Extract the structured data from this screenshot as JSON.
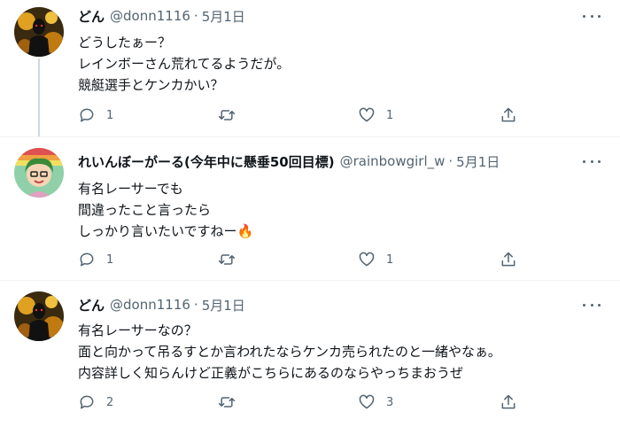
{
  "tweets": [
    {
      "name": "どん",
      "handle": "@donn1116",
      "separator": "·",
      "date": "5月1日",
      "lines": [
        "どうしたぁー？",
        "レインボーさん荒れてるようだが。",
        "競艇選手とケンカかい？"
      ],
      "reply_count": "1",
      "retweet_count": "",
      "like_count": "1",
      "avatar_icon": "dark-figure-avatar"
    },
    {
      "name": "れいんぼーがーる(今年中に懸垂50回目標)",
      "handle": "@rainbowgirl_w",
      "separator": "·",
      "date": "5月1日",
      "lines": [
        "有名レーサーでも",
        "間違ったこと言ったら",
        "しっかり言いたいですねー"
      ],
      "emoji": "🔥",
      "reply_count": "1",
      "retweet_count": "",
      "like_count": "1",
      "avatar_icon": "cartoon-girl-avatar"
    },
    {
      "name": "どん",
      "handle": "@donn1116",
      "separator": "·",
      "date": "5月1日",
      "lines": [
        "有名レーサーなの？",
        "面と向かって吊るすとか言われたならケンカ売られたのと一緒やなぁ。",
        "内容詳しく知らんけど正義がこちらにあるのならやっちまおうぜ"
      ],
      "reply_count": "2",
      "retweet_count": "",
      "like_count": "3",
      "avatar_icon": "dark-figure-avatar"
    }
  ],
  "colors": {
    "text": "#0f1419",
    "secondary": "#536471",
    "divider": "#eff3f4",
    "thread_line": "#cfd9de"
  }
}
